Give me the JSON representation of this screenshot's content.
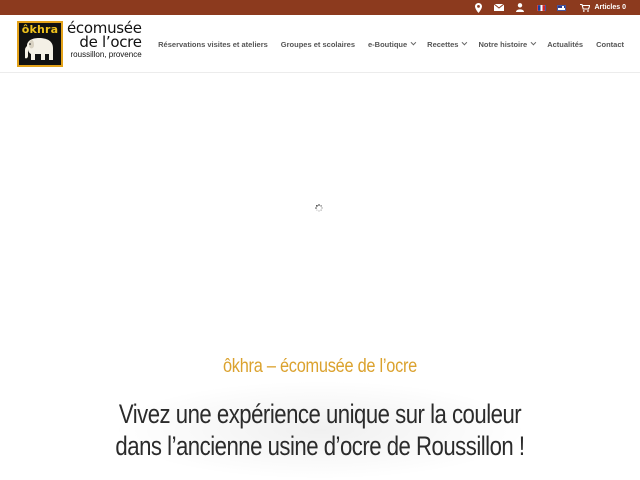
{
  "topbar": {
    "icons": [
      "map-pin-icon",
      "envelope-icon",
      "user-icon"
    ],
    "languages": [
      "fr",
      "en"
    ],
    "cart_label": "Articles 0",
    "colors": {
      "background": "#8c3a1e"
    }
  },
  "logo": {
    "brand": "ôkhra",
    "line1": "écomusée",
    "line2": "de l’ocre",
    "line3": "roussillon, provence"
  },
  "nav": {
    "items": [
      {
        "label": "Réservations visites et ateliers",
        "has_dropdown": false
      },
      {
        "label": "Groupes et scolaires",
        "has_dropdown": false
      },
      {
        "label": "e-Boutique",
        "has_dropdown": true
      },
      {
        "label": "Recettes",
        "has_dropdown": true
      },
      {
        "label": "Notre histoire",
        "has_dropdown": true
      },
      {
        "label": "Actualités",
        "has_dropdown": false
      },
      {
        "label": "Contact",
        "has_dropdown": false
      }
    ]
  },
  "hero": {
    "subtitle": "ôkhra – écomusée de l’ocre",
    "title_line1": "Vivez une expérience unique sur la couleur",
    "title_line2": "dans l’ancienne usine d’ocre de Roussillon !",
    "colors": {
      "subtitle": "#dba22e",
      "title": "#2b2b2b"
    }
  }
}
